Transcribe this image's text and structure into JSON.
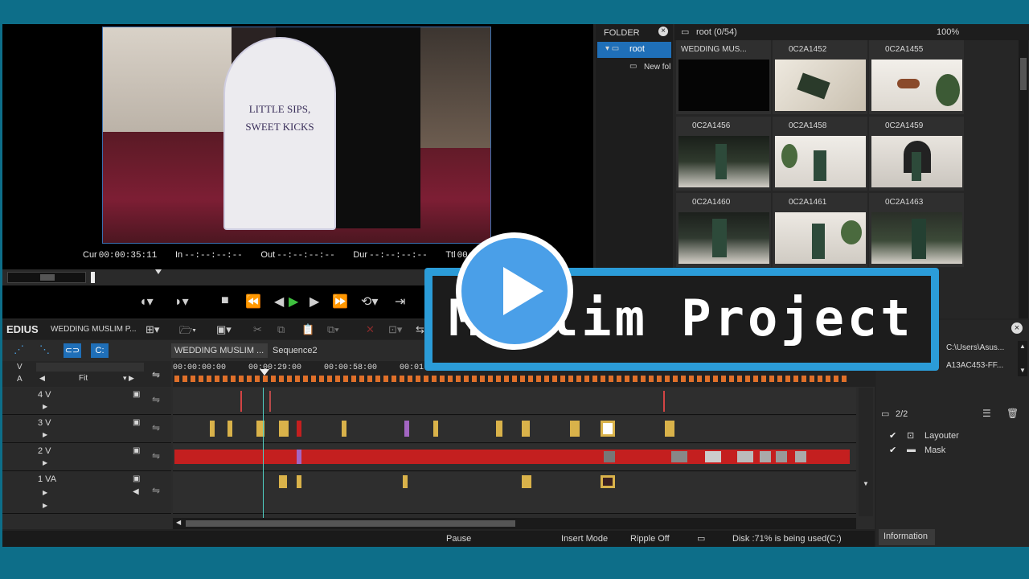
{
  "player": {
    "timecodes": [
      {
        "label": "Cur",
        "value": "00:00:35:11"
      },
      {
        "label": "In",
        "value": "--:--:--:--"
      },
      {
        "label": "Out",
        "value": "--:--:--:--"
      },
      {
        "label": "Dur",
        "value": "--:--:--:--"
      },
      {
        "label": "Ttl",
        "value": "00:0"
      }
    ],
    "sign_lines": [
      "LITTLE SIPS,",
      "SWEET KICKS"
    ]
  },
  "bin": {
    "folder_header": "FOLDER",
    "root_path": "root (0/54)",
    "zoom": "100%",
    "tree": [
      {
        "label": "root"
      },
      {
        "label": "New fol"
      }
    ],
    "clips": [
      {
        "name": "WEDDING MUS...",
        "color": "#050505"
      },
      {
        "name": "0C2A1452",
        "color": "#d9d2c4"
      },
      {
        "name": "0C2A1455",
        "color": "#e8e4df"
      },
      {
        "name": "0C2A1456",
        "color": "#3f4a3e"
      },
      {
        "name": "0C2A1458",
        "color": "#e6e3df"
      },
      {
        "name": "0C2A1459",
        "color": "#ddd8d2"
      },
      {
        "name": "0C2A1460",
        "color": "#3a3f37"
      },
      {
        "name": "0C2A1461",
        "color": "#e2ddd6"
      },
      {
        "name": "0C2A1463",
        "color": "#444a3f"
      }
    ]
  },
  "timeline": {
    "app_name": "EDIUS",
    "project_name": "WEDDING MUSLIM P...",
    "tabs": [
      "WEDDING MUSLIM ...",
      "Sequence2"
    ],
    "ruler": [
      "00:00:00:00",
      "00:00:29:00",
      "00:00:58:00",
      "00:01:"
    ],
    "zoom_label": "Fit",
    "va_labels": [
      "V",
      "A"
    ],
    "tracks": [
      {
        "name": "4 V"
      },
      {
        "name": "3 V"
      },
      {
        "name": "2 V"
      },
      {
        "name": "1 VA"
      }
    ]
  },
  "info": {
    "path1": "C:\\Users\\Asus...",
    "path2": "A13AC453-FF...",
    "count": "2/2",
    "effects": [
      "Layouter",
      "Mask"
    ],
    "tab": "Information"
  },
  "status": {
    "pause": "Pause",
    "insert_mode": "Insert Mode",
    "ripple": "Ripple Off",
    "disk": "Disk :71% is being used(C:)"
  },
  "overlay": {
    "title": "Muslim Project"
  },
  "colors": {
    "frame": "#0d6e89",
    "accent": "#2b9cd8",
    "clip_red": "#c41f1f",
    "clip_yellow": "#d9b24a",
    "play_blue": "#4a9fe8"
  }
}
